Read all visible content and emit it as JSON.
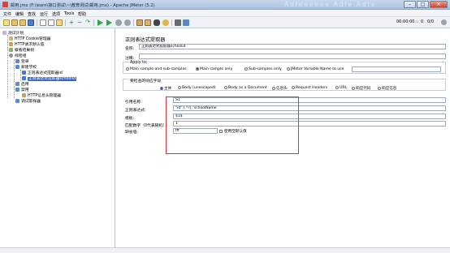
{
  "window": {
    "title": "邮用.jmx (F:\\learn\\接口测试\\~\\教育测试\\邮用.jmx) - Apache JMeter (5.2)",
    "watermark": "Adfeeeeee Adfe Adfe",
    "min_label": "–",
    "max_label": "□",
    "close_label": "✕"
  },
  "menu": [
    "文件",
    "编辑",
    "查找",
    "运行",
    "选项",
    "Tools",
    "帮助"
  ],
  "toolbar": {
    "timer": "00:00:00",
    "warn_count": "0",
    "ratio": "0/0"
  },
  "tree": [
    {
      "label": "测试计划",
      "icon": "testplan-icon"
    },
    {
      "label": "HTTP Cookie管理器",
      "icon": "cookie-manager-icon"
    },
    {
      "label": "HTTP请求默认值",
      "icon": "http-defaults-icon"
    },
    {
      "label": "察看结果树",
      "icon": "results-tree-icon"
    },
    {
      "label": "线程组",
      "icon": "thread-group-icon"
    },
    {
      "label": "登录",
      "icon": "sampler-icon"
    },
    {
      "label": "新建学校",
      "icon": "sampler-icon"
    },
    {
      "label": "正则表达式提取器id",
      "icon": "extractor-icon"
    },
    {
      "label": "正则表达式提取器schoolid",
      "icon": "extractor-icon"
    },
    {
      "label": "启用",
      "icon": "sampler-icon"
    },
    {
      "label": "禁用",
      "icon": "sampler-icon"
    },
    {
      "label": "HTTP信息头管理器",
      "icon": "header-manager-icon"
    },
    {
      "label": "调试取样器",
      "icon": "debug-sampler-icon"
    }
  ],
  "editor": {
    "heading": "正则表达式提取器",
    "name_label": "名称:",
    "name_value": "正则表达式提取器schoolid",
    "comment_label": "注释:",
    "comment_value": "",
    "apply_to_label": "Apply to:",
    "apply_to_options": [
      "Main sample and sub-samples",
      "Main sample only",
      "Sub-samples only",
      "JMeter Variable Name to use"
    ],
    "apply_to_selected": 1,
    "apply_var_value": "",
    "field_check_label": "要检查的响应字段",
    "field_check_options": [
      "主体",
      "Body (unescaped)",
      "Body as a Document",
      "信息头",
      "Request Headers",
      "URL",
      "响应代码",
      "响应信息"
    ],
    "field_check_selected": 0,
    "ref_name_label": "引用名称:",
    "ref_name_value": "S1",
    "regex_label": "正则表达式:",
    "regex_value": "\"id\":(.*?),\"schoolName",
    "template_label": "模板:",
    "template_value": "$1$",
    "match_no_label": "匹配数字（0代表随机）:",
    "match_no_value": "1",
    "default_label": "缺省值:",
    "default_value": "fff",
    "empty_default_label": "使用空默认值"
  },
  "colors": {
    "highlight": "#e0343a",
    "selection": "#2f64c8"
  }
}
